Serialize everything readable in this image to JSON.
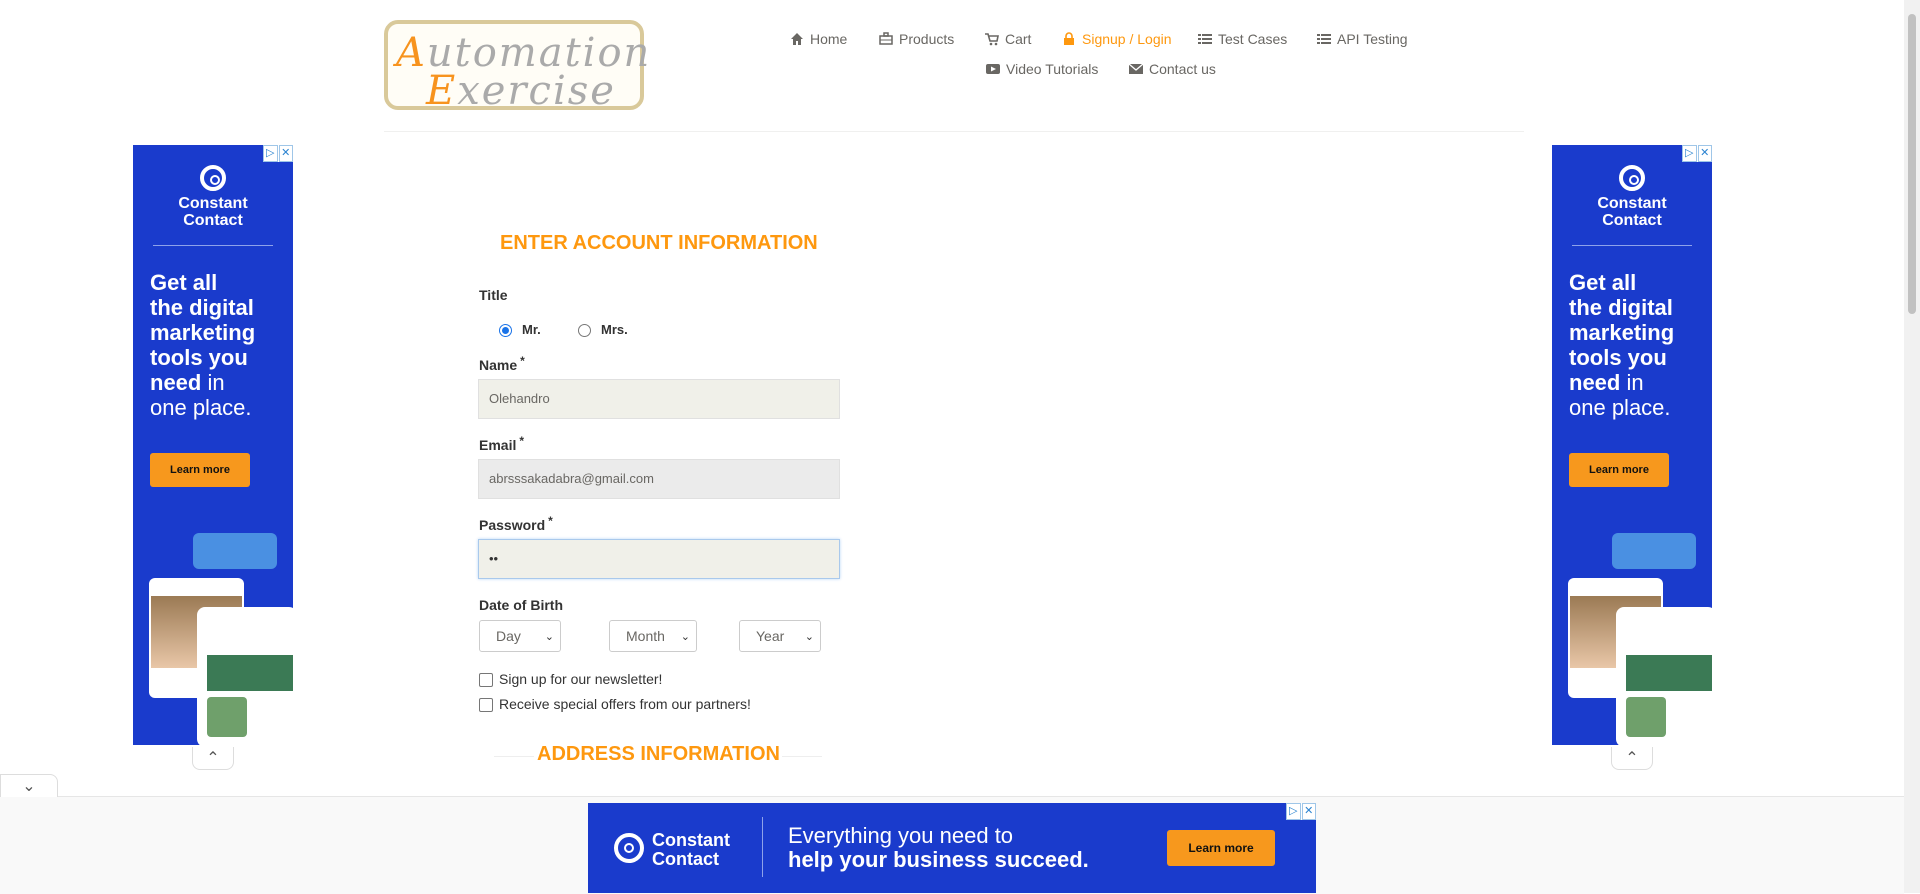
{
  "logo": {
    "line1_cap": "A",
    "line1_rest": "utomation",
    "line2_cap": "E",
    "line2_rest": "xercise"
  },
  "nav": [
    {
      "label": "Home",
      "icon": "home-icon"
    },
    {
      "label": "Products",
      "icon": "products-icon"
    },
    {
      "label": "Cart",
      "icon": "cart-icon"
    },
    {
      "label": "Signup / Login",
      "icon": "lock-icon",
      "active": true
    },
    {
      "label": "Test Cases",
      "icon": "list-icon"
    },
    {
      "label": "API Testing",
      "icon": "list-icon"
    },
    {
      "label": "Video Tutorials",
      "icon": "youtube-icon"
    },
    {
      "label": "Contact us",
      "icon": "envelope-icon"
    }
  ],
  "ad_side": {
    "brand_line1": "Constant",
    "brand_line2": "Contact",
    "headline_bold1": "Get all",
    "headline_bold2": "the digital",
    "headline_bold3": "marketing",
    "headline_bold4": "tools you",
    "headline_bold5": "need",
    "headline_thin5": " in",
    "headline_thin6": "one place.",
    "button": "Learn more"
  },
  "form": {
    "heading": "ENTER ACCOUNT INFORMATION",
    "title_label": "Title",
    "title_options": [
      {
        "label": "Mr.",
        "checked": true
      },
      {
        "label": "Mrs.",
        "checked": false
      }
    ],
    "name_label": "Name",
    "name_value": "Olehandro",
    "email_label": "Email",
    "email_value": "abrsssakadabra@gmail.com",
    "password_label": "Password",
    "password_value": "••",
    "required_mark": "*",
    "dob_label": "Date of Birth",
    "day": "Day",
    "month": "Month",
    "year": "Year",
    "newsletter": "Sign up for our newsletter!",
    "offers": "Receive special offers from our partners!",
    "address_heading": "ADDRESS INFORMATION"
  },
  "ad_bottom": {
    "brand_line1": "Constant",
    "brand_line2": "Contact",
    "text1": "Everything you need to",
    "text2": "help your business succeed.",
    "button": "Learn more"
  },
  "ad_controls": {
    "adchoices": "▷",
    "close": "✕",
    "expand": "⌃",
    "collapse": "⌄"
  },
  "colors": {
    "accent": "#fe980f",
    "ad_blue": "#1a3bcc",
    "ad_button": "#f7981d"
  }
}
